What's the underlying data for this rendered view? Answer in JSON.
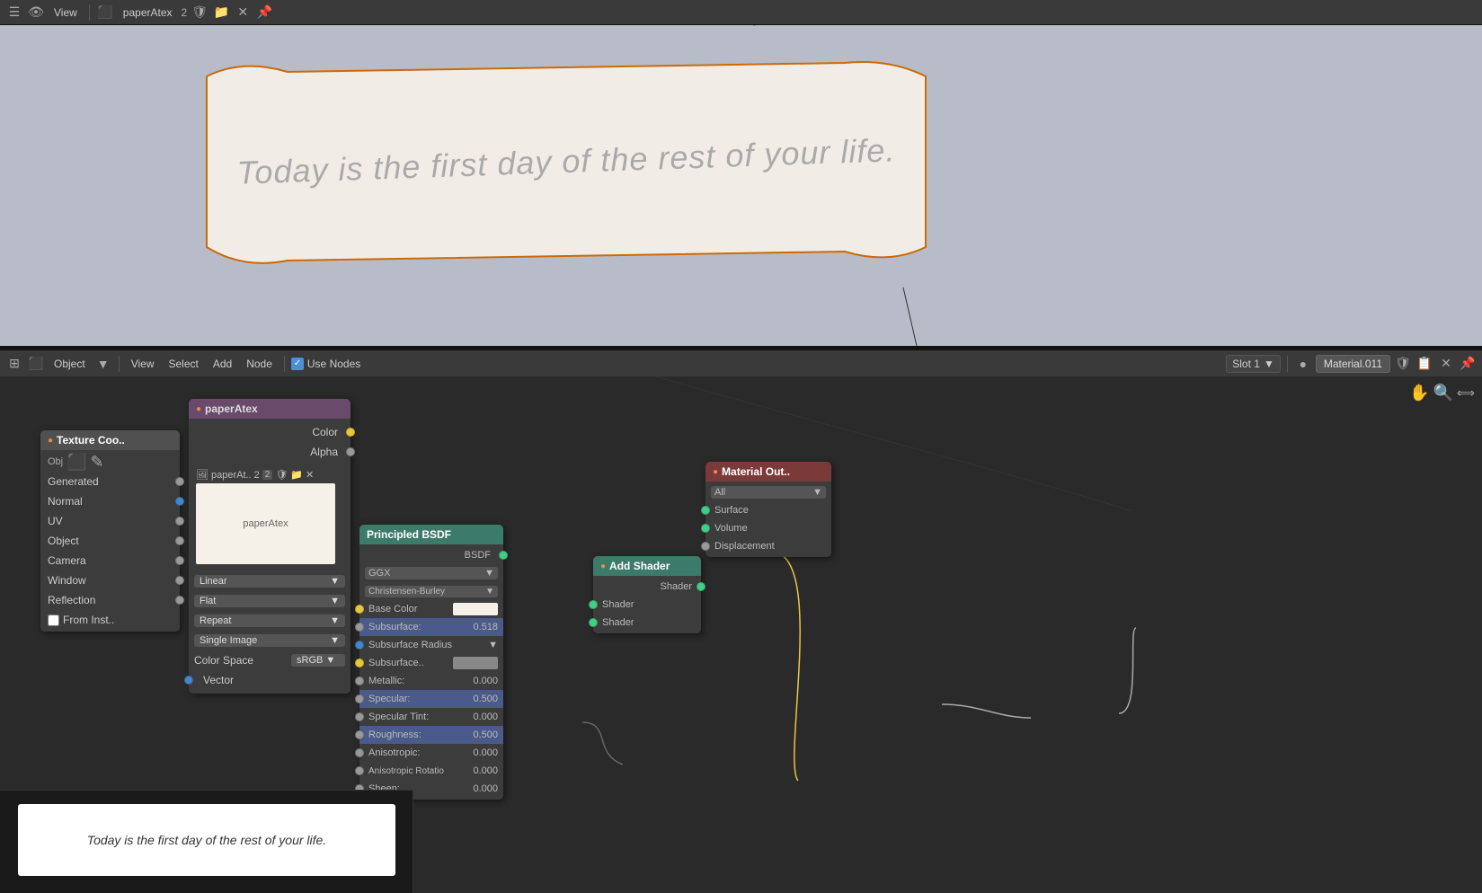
{
  "viewport": {
    "banner_text": "Today is the first day of the rest of your life.",
    "background_color": "#b8bcc8"
  },
  "top_toolbar": {
    "view_label": "View",
    "file_label": "paperAtex",
    "num": "2",
    "icon_mode": "☰"
  },
  "node_toolbar": {
    "object_label": "Object",
    "view_label": "View",
    "select_label": "Select",
    "add_label": "Add",
    "node_label": "Node",
    "use_nodes_label": "Use Nodes",
    "slot_label": "Slot 1",
    "material_label": "Material.011"
  },
  "nodes": {
    "texture_coordinate": {
      "header": "Texture Coo..",
      "sockets_out": [
        "Generated",
        "Normal",
        "UV",
        "Object",
        "Camera",
        "Window",
        "Reflection"
      ],
      "from_inst": "From Inst.."
    },
    "paper_atex": {
      "header": "paperAtex",
      "socket_out_color": "Color",
      "socket_out_alpha": "Alpha",
      "image_name": "paperAt.. 2",
      "dropdowns": [
        {
          "label": "Linear",
          "value": "Linear"
        },
        {
          "label": "Flat",
          "value": "Flat"
        },
        {
          "label": "Repeat",
          "value": "Repeat"
        },
        {
          "label": "Single Image",
          "value": "Single Image"
        },
        {
          "label": "Color Space",
          "value": "sRGB"
        }
      ],
      "vector_label": "Vector"
    },
    "principled_bsdf": {
      "header": "Principled BSDF",
      "top_label": "BSDF",
      "distribution": "GGX",
      "subsurface_method": "Christensen-Burley",
      "rows": [
        {
          "label": "Base Color",
          "type": "color",
          "highlighted": false
        },
        {
          "label": "Subsurface:",
          "value": "0.518",
          "highlighted": true
        },
        {
          "label": "Subsurface Radius",
          "type": "dropdown",
          "highlighted": false
        },
        {
          "label": "Subsurface..",
          "type": "color2",
          "highlighted": false
        },
        {
          "label": "Metallic:",
          "value": "0.000",
          "highlighted": false
        },
        {
          "label": "Specular:",
          "value": "0.500",
          "highlighted": true
        },
        {
          "label": "Specular Tint:",
          "value": "0.000",
          "highlighted": false
        },
        {
          "label": "Roughness:",
          "value": "0.500",
          "highlighted": true
        },
        {
          "label": "Anisotropic:",
          "value": "0.000",
          "highlighted": false
        },
        {
          "label": "Anisotropic Rotatio",
          "value": "0.000",
          "highlighted": false
        },
        {
          "label": "Sheen:",
          "value": "0.000",
          "highlighted": false
        }
      ]
    },
    "material_output": {
      "header": "Material Out..",
      "dropdown": "All",
      "sockets_in": [
        "Surface",
        "Volume",
        "Displacement"
      ]
    },
    "add_shader": {
      "header": "Add Shader",
      "socket_out": "Shader",
      "sockets_in": [
        "Shader",
        "Shader"
      ]
    }
  },
  "preview": {
    "text": "Today is the first day of the rest of your life."
  }
}
